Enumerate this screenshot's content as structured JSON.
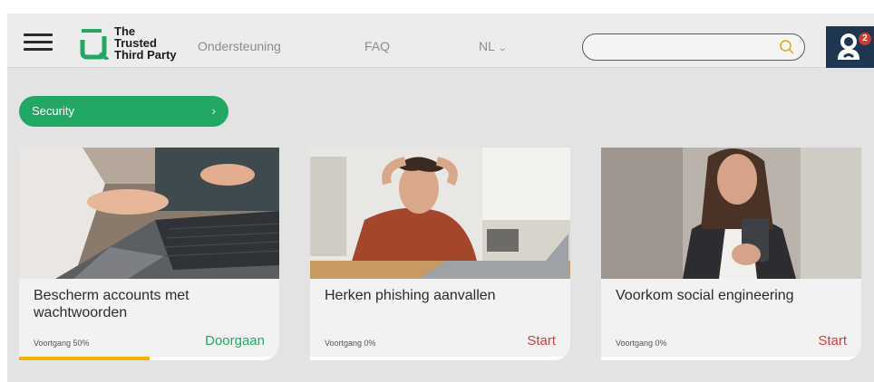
{
  "header": {
    "logo_lines": [
      "The",
      "Trusted",
      "Third Party"
    ],
    "nav": {
      "support": "Ondersteuning",
      "faq": "FAQ",
      "language": "NL"
    },
    "search": {
      "value": "",
      "placeholder": ""
    },
    "notifications_count": "2"
  },
  "category": {
    "label": "Security"
  },
  "cards": [
    {
      "title": "Bescherm accounts met wachtwoorden",
      "progress_label": "Voortgang 50%",
      "progress_fraction": 0.5,
      "action": "Doorgaan"
    },
    {
      "title": "Herken phishing aanvallen",
      "progress_label": "Voortgang 0%",
      "progress_fraction": 0,
      "action": "Start"
    },
    {
      "title": "Voorkom social engineering",
      "progress_label": "Voortgang 0%",
      "progress_fraction": 0,
      "action": "Start"
    }
  ],
  "colors": {
    "brand_green": "#22a864",
    "progress_yellow": "#f0b400",
    "start_red": "#d04040",
    "profile_navy": "#1e3650",
    "badge_red": "#d63636"
  },
  "icons": {
    "menu": "hamburger-menu-icon",
    "search": "search-icon",
    "profile": "user-profile-icon",
    "language_dropdown": "chevron-down-icon",
    "category_arrow": "chevron-right-icon"
  }
}
